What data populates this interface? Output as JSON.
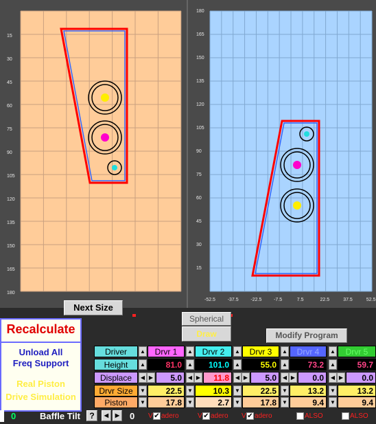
{
  "left_plot": {
    "y_ticks": [
      "15",
      "30",
      "45",
      "60",
      "75",
      "90",
      "105",
      "120",
      "135",
      "150",
      "165",
      "180"
    ]
  },
  "right_plot": {
    "y_ticks": [
      "180",
      "165",
      "150",
      "135",
      "120",
      "105",
      "90",
      "75",
      "60",
      "45",
      "30",
      "15"
    ],
    "x_ticks": [
      "-52.5",
      "-37.5",
      "-22.5",
      "-7.5",
      "7.5",
      "22.5",
      "37.5",
      "52.5"
    ]
  },
  "buttons": {
    "next_size": "Next Size",
    "recalculate": "Recalculate",
    "unload_all_line1": "Unload All",
    "unload_all_line2": "Freq Support",
    "real_piston_line1": "Real Piston",
    "real_piston_line2": "Drive Simulation",
    "spherical": "Spherical",
    "draw": "Draw",
    "modify_program": "Modify Program"
  },
  "table": {
    "row_labels": [
      "Driver",
      "Height",
      "Displace",
      "Drvr Size",
      "Piston"
    ],
    "drivers": [
      {
        "name": "Drvr 1",
        "height": "81.0",
        "displace": "5.0",
        "size": "22.5",
        "piston": "17.8"
      },
      {
        "name": "Drvr 2",
        "height": "101.0",
        "displace": "11.8",
        "size": "10.3",
        "piston": "2.7"
      },
      {
        "name": "Drvr 3",
        "height": "55.0",
        "displace": "5.0",
        "size": "22.5",
        "piston": "17.8"
      },
      {
        "name": "Drvr 4",
        "height": "73.2",
        "displace": "0.0",
        "size": "13.2",
        "piston": "9.4"
      },
      {
        "name": "Drvr 5",
        "height": "59.7",
        "displace": "0.0",
        "size": "13.2",
        "piston": "9.4"
      }
    ]
  },
  "status": {
    "left_value": "0",
    "baffle_tilt_label": "Baffle Tilt",
    "help": "?",
    "tilt_value": "0",
    "checks": [
      {
        "prefix": "V",
        "label": "adero",
        "checked": true
      },
      {
        "prefix": "V",
        "label": "adero",
        "checked": true
      },
      {
        "prefix": "V",
        "label": "adero",
        "checked": true
      },
      {
        "prefix": "",
        "label": "ALSO",
        "checked": false
      },
      {
        "prefix": "",
        "label": "ALSO",
        "checked": false
      }
    ]
  },
  "colors": {
    "left_plot_bg": "#ffcc99",
    "right_plot_bg": "#aad4ff",
    "baffle_red": "#ff0000",
    "baffle_blue": "#3366ff",
    "label_cyan": "#66dddd",
    "label_purple": "#cc99ff",
    "label_orange": "#ffaa33",
    "label_salmon": "#ffaa66"
  }
}
